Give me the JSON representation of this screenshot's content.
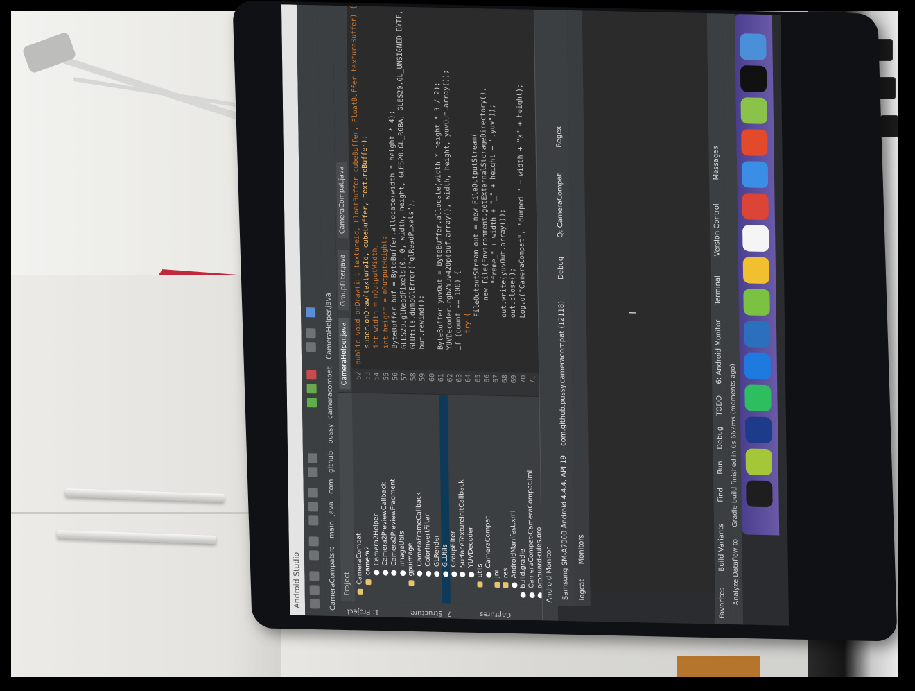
{
  "ide": {
    "app_name": "Android Studio",
    "side_tabs": [
      "1: Project",
      "7: Structure",
      "Captures"
    ],
    "breadcrumbs": [
      "CameraCompat",
      "src",
      "main",
      "java",
      "com",
      "github",
      "pussy",
      "cameracompat",
      "CameraHelper.java"
    ],
    "project_header": "Project",
    "tree": [
      {
        "label": "CameraCompat",
        "kind": "folder",
        "indent": 0
      },
      {
        "label": "camera2",
        "kind": "pkg",
        "indent": 1
      },
      {
        "label": "Camera2Helper",
        "kind": "cls",
        "indent": 2
      },
      {
        "label": "Camera2PreviewCallback",
        "kind": "cls",
        "indent": 2
      },
      {
        "label": "Camera2PreviewFragment",
        "kind": "cls",
        "indent": 2
      },
      {
        "label": "ImageUtils",
        "kind": "cls",
        "indent": 2
      },
      {
        "label": "gpuimage",
        "kind": "pkg",
        "indent": 1
      },
      {
        "label": "CameraFrameCallback",
        "kind": "cls",
        "indent": 2
      },
      {
        "label": "ColorInvertFilter",
        "kind": "cls",
        "indent": 2
      },
      {
        "label": "GLRender",
        "kind": "cls",
        "indent": 2
      },
      {
        "label": "GLUtils",
        "kind": "cls",
        "indent": 2,
        "selected": true
      },
      {
        "label": "GroupFilter",
        "kind": "cls",
        "indent": 2
      },
      {
        "label": "SurfaceTextureInitCallback",
        "kind": "cls",
        "indent": 2
      },
      {
        "label": "YUVDecoder",
        "kind": "cls",
        "indent": 2
      },
      {
        "label": "utils",
        "kind": "pkg",
        "indent": 1
      },
      {
        "label": "CameraCompat",
        "kind": "cls",
        "indent": 2
      },
      {
        "label": "jni",
        "kind": "folder",
        "indent": 1
      },
      {
        "label": "res",
        "kind": "folder",
        "indent": 1
      },
      {
        "label": "AndroidManifest.xml",
        "kind": "file",
        "indent": 1
      },
      {
        "label": "build.gradle",
        "kind": "file",
        "indent": 0
      },
      {
        "label": "CameraCompat-CameraCompat.iml",
        "kind": "file",
        "indent": 0
      },
      {
        "label": "proguard-rules.pro",
        "kind": "file",
        "indent": 0
      }
    ],
    "editor_tabs": [
      "CameraHelper.java",
      "GroupFilter.java",
      "CameraCompat.java"
    ],
    "line_numbers": [
      "52",
      "53",
      "54",
      "55",
      "56",
      "57",
      "58",
      "59",
      "60",
      "61",
      "62",
      "63",
      "64",
      "65",
      "66",
      "67",
      "68",
      "69",
      "70",
      "71"
    ],
    "code_lines": [
      {
        "text": "public void onDraw(int textureId, FloatBuffer cubeBuffer, FloatBuffer textureBuffer) {",
        "kind": "kw"
      },
      {
        "text": "    super.onDraw(textureId, cubeBuffer, textureBuffer);",
        "kind": "fn"
      },
      {
        "text": "    int width = mOutputWidth;",
        "kind": "kw"
      },
      {
        "text": "    int height = mOutputHeight;",
        "kind": "kw"
      },
      {
        "text": "    ByteBuffer buf = ByteBuffer.allocate(width * height * 4);",
        "kind": "plain"
      },
      {
        "text": "    GLES20.glReadPixels(0, 0, width, height, GLES20.GL_RGBA, GLES20.GL_UNSIGNED_BYTE, buf);",
        "kind": "plain"
      },
      {
        "text": "    GLUtils.dumpGlError(\"glReadPixels\");",
        "kind": "plain"
      },
      {
        "text": "    buf.rewind();",
        "kind": "plain"
      },
      {
        "text": "",
        "kind": "plain"
      },
      {
        "text": "    ByteBuffer yuvOut = ByteBuffer.allocate(width * height * 3 / 2);",
        "kind": "plain"
      },
      {
        "text": "    YUVDecoder.rgb2Yuv420p(buf.array(), width, height, yuvOut.array());",
        "kind": "plain"
      },
      {
        "text": "    if (count == 100) {",
        "kind": "plain"
      },
      {
        "text": "        try {",
        "kind": "kw"
      },
      {
        "text": "            FileOutputStream out = new FileOutputStream(",
        "kind": "plain"
      },
      {
        "text": "                new File(Environment.getExternalStorageDirectory(),",
        "kind": "plain"
      },
      {
        "text": "                    \"frame_\" + width + \"_\" + height + \".yuv\"));",
        "kind": "plain"
      },
      {
        "text": "            out.write(yuvOut.array());",
        "kind": "plain"
      },
      {
        "text": "            out.close();",
        "kind": "plain"
      },
      {
        "text": "            Log.d(\"CameraCompat\", \"dumped \" + width + \"x\" + height);",
        "kind": "plain"
      },
      {
        "text": "",
        "kind": "plain"
      }
    ],
    "android_monitor": {
      "title": "Android Monitor",
      "device": "Samsung SM-A7000 Android 4.4.4, API 19",
      "process": "com.github.pussy.cameracompat (12118)",
      "log_level": "Debug",
      "filter": "Q: CameraCompat",
      "regex": "Regex",
      "sub_tabs": [
        "logcat",
        "Monitors"
      ]
    },
    "bottom_tools": [
      "Favorites",
      "Build Variants",
      "Find",
      "Run",
      "Debug",
      "TODO",
      "6: Android Monitor",
      "Terminal",
      "Version Control",
      "Messages"
    ],
    "status_text": "Analyze Dataflow to",
    "status_text_2": "Gradle build finished in 6s 662ms (moments ago)"
  },
  "dock": {
    "icons": [
      {
        "name": "terminal-icon",
        "color": "#1e1e1e"
      },
      {
        "name": "android-icon",
        "color": "#a4c639"
      },
      {
        "name": "intellij-icon",
        "color": "#1e3a8a"
      },
      {
        "name": "evernote-icon",
        "color": "#2dbe60"
      },
      {
        "name": "xcode-icon",
        "color": "#1f7ae0"
      },
      {
        "name": "app-icon",
        "color": "#2c6fbd"
      },
      {
        "name": "chat-icon",
        "color": "#7cc242"
      },
      {
        "name": "qq-icon",
        "color": "#f2c02f"
      },
      {
        "name": "calendar-icon",
        "color": "#f5f5f5"
      },
      {
        "name": "chrome-icon",
        "color": "#db4437"
      },
      {
        "name": "finder-icon",
        "color": "#3a8ee6"
      },
      {
        "name": "slides-icon",
        "color": "#e24a2b"
      },
      {
        "name": "android-studio-icon",
        "color": "#8bc34a"
      },
      {
        "name": "ghost-icon",
        "color": "#111111"
      },
      {
        "name": "photos-icon",
        "color": "#4a90d9"
      }
    ]
  },
  "colors": {
    "ide_bg": "#2b2b2b",
    "panel_bg": "#3c3f41",
    "selection": "#0d3a58",
    "keyword": "#cc7832",
    "method": "#ffc66d",
    "room_wall": "#e9e8e4",
    "red_paper": "#c0283c",
    "desk": "#b5752c"
  }
}
